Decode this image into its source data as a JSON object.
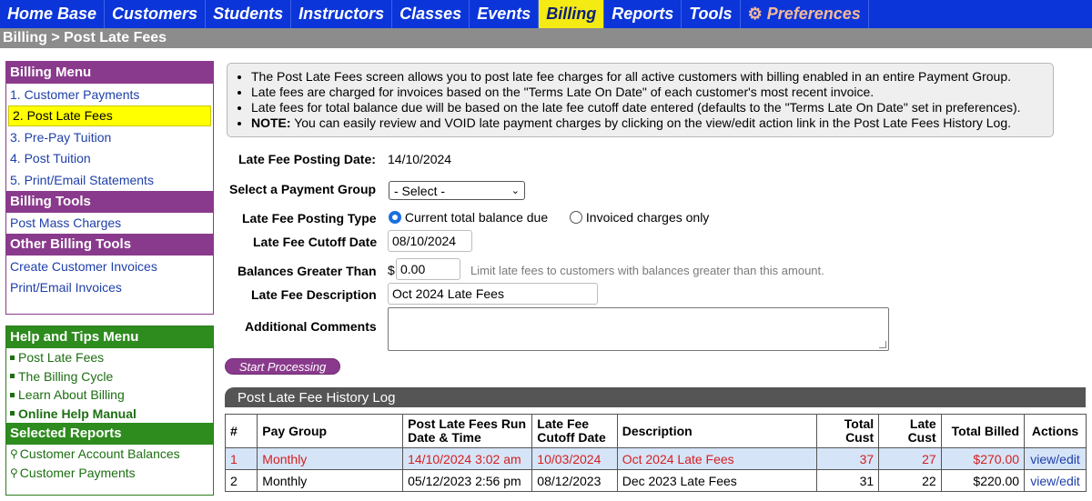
{
  "nav": {
    "items": [
      "Home Base",
      "Customers",
      "Students",
      "Instructors",
      "Classes",
      "Events",
      "Billing",
      "Reports",
      "Tools"
    ],
    "preferences": "Preferences",
    "active": "Billing"
  },
  "breadcrumb": "Billing > Post Late Fees",
  "billing_menu": {
    "title": "Billing Menu",
    "items": [
      "1. Customer Payments",
      "2. Post Late Fees",
      "3. Pre-Pay Tuition",
      "4. Post Tuition",
      "5. Print/Email Statements"
    ],
    "tools_title": "Billing Tools",
    "tools": [
      "Post Mass Charges"
    ],
    "other_title": "Other Billing Tools",
    "other": [
      "Create Customer Invoices",
      "Print/Email Invoices"
    ]
  },
  "help_menu": {
    "title": "Help and Tips Menu",
    "items": [
      "Post Late Fees",
      "The Billing Cycle",
      "Learn About Billing",
      "Online Help Manual"
    ],
    "reports_title": "Selected Reports",
    "reports": [
      "Customer Account Balances",
      "Customer Payments"
    ]
  },
  "info": {
    "line1": "The Post Late Fees screen allows you to post late fee charges for all active customers with billing enabled in an entire Payment Group.",
    "line2": "Late fees are charged for invoices based on the \"Terms Late On Date\" of each customer's most recent invoice.",
    "line3": "Late fees for total balance due will be based on the late fee cutoff date entered (defaults to the \"Terms Late On Date\" set in preferences).",
    "note_label": "NOTE:",
    "line4": "You can easily review and VOID late payment charges by clicking on the view/edit action link in the Post Late Fees History Log."
  },
  "form": {
    "posting_date_label": "Late Fee Posting Date:",
    "posting_date": "14/10/2024",
    "payment_group_label": "Select a Payment Group",
    "payment_group_value": "- Select -",
    "posting_type_label": "Late Fee Posting Type",
    "posting_type_opt1": "Current total balance due",
    "posting_type_opt2": "Invoiced charges only",
    "cutoff_label": "Late Fee Cutoff Date",
    "cutoff_value": "08/10/2024",
    "balances_label": "Balances Greater Than",
    "currency": "$",
    "balances_value": "0.00",
    "balances_hint": "Limit late fees to customers with balances greater than this amount.",
    "description_label": "Late Fee Description",
    "description_value": "Oct 2024 Late Fees",
    "comments_label": "Additional Comments",
    "comments_value": "",
    "start_button": "Start Processing"
  },
  "history": {
    "title": "Post Late Fee History Log",
    "columns": [
      "#",
      "Pay Group",
      "Post Late Fees Run Date & Time",
      "Late Fee Cutoff Date",
      "Description",
      "Total Cust",
      "Late Cust",
      "Total Billed",
      "Actions"
    ],
    "rows": [
      {
        "num": "1",
        "group": "Monthly",
        "run": "14/10/2024 3:02 am",
        "cutoff": "10/03/2024",
        "desc": "Oct 2024 Late Fees",
        "total": "37",
        "late": "27",
        "billed": "$270.00",
        "action": "view/edit"
      },
      {
        "num": "2",
        "group": "Monthly",
        "run": "05/12/2023 2:56 pm",
        "cutoff": "08/12/2023",
        "desc": "Dec 2023 Late Fees",
        "total": "31",
        "late": "22",
        "billed": "$220.00",
        "action": "view/edit"
      }
    ]
  },
  "colors": {
    "nav_bg": "#0b35d8",
    "nav_active": "#f4ea14",
    "sidebar_purple": "#8a3a8c",
    "sidebar_green": "#2e8b1e",
    "highlight_row": "#d6e4f7",
    "highlight_text": "#d42020"
  }
}
